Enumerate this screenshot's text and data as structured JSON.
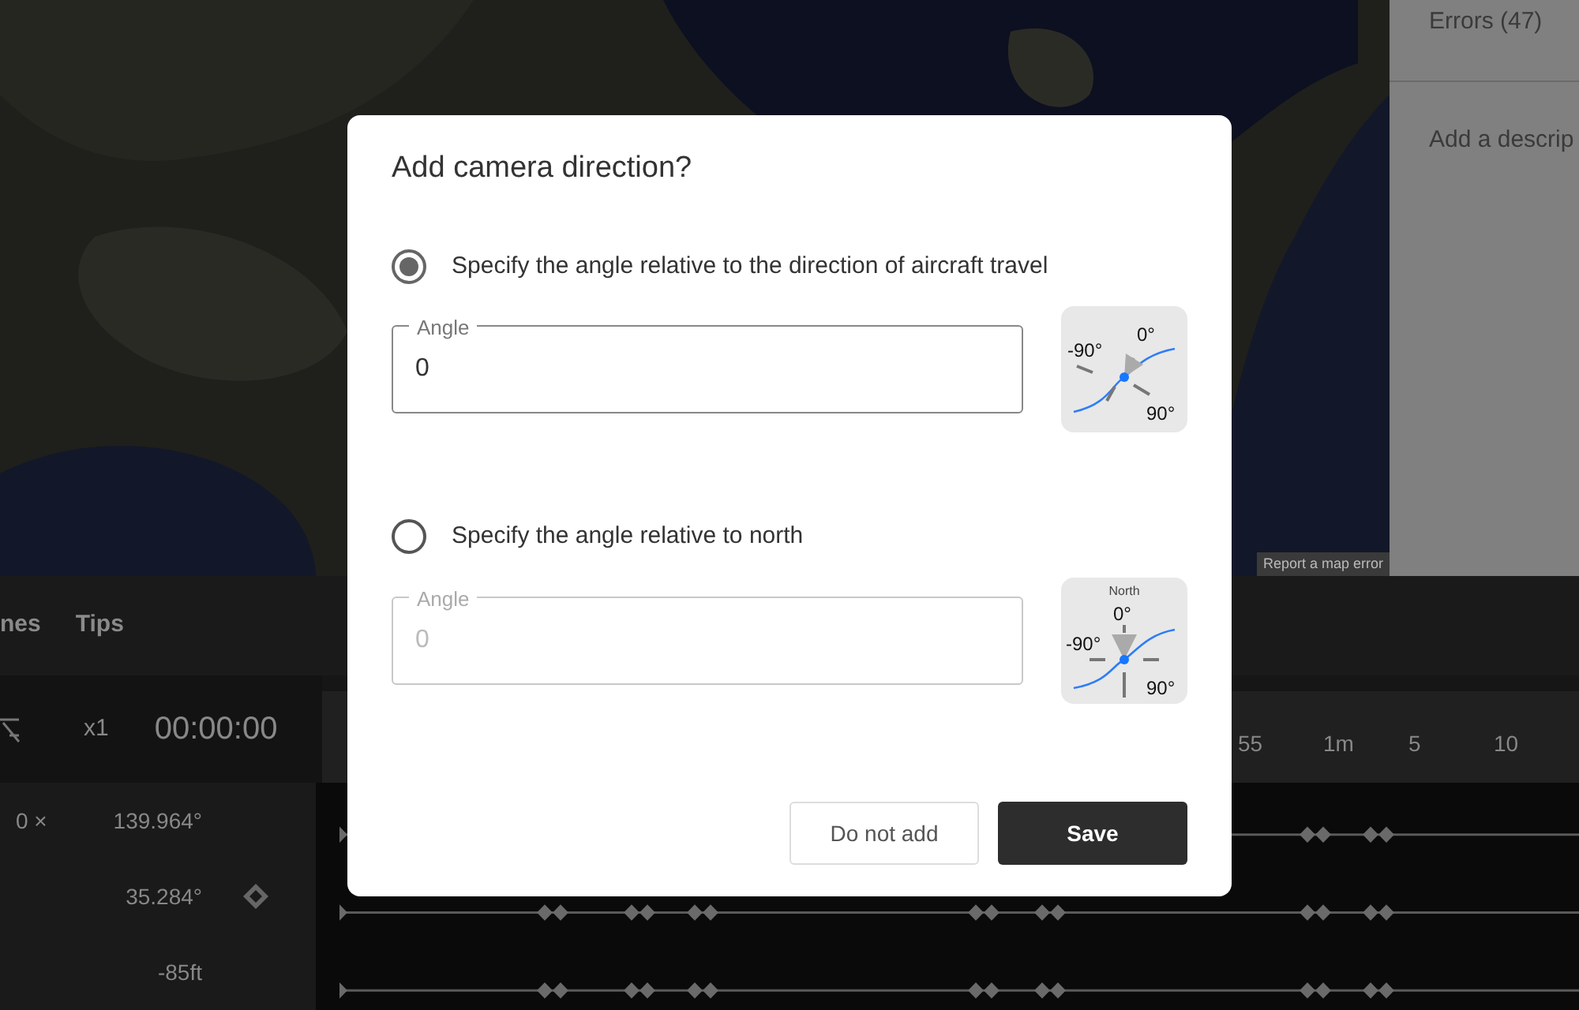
{
  "map": {
    "attribution": "Report a map error"
  },
  "side_panel": {
    "items": [
      "Errors (47)",
      "Add a descrip"
    ]
  },
  "bottom_panel": {
    "tabs": [
      "nes",
      "Tips"
    ],
    "speed": "x1",
    "time": "00:00:00",
    "ruler_labels": [
      "55",
      "1m",
      "5",
      "10"
    ],
    "rows": [
      {
        "count": "0 ×",
        "value": "139.964°",
        "keyframe": false
      },
      {
        "value": "35.284°",
        "keyframe": true
      },
      {
        "value": "-85ft",
        "keyframe": false
      }
    ]
  },
  "dialog": {
    "title": "Add camera direction?",
    "options": [
      {
        "label": "Specify the angle relative to the direction of aircraft travel",
        "selected": true,
        "field": {
          "label": "Angle",
          "value": "0",
          "disabled": false
        },
        "diagram": {
          "kind": "travel",
          "labels": [
            "-90°",
            "0°",
            "90°"
          ]
        }
      },
      {
        "label": "Specify the angle relative to north",
        "selected": false,
        "field": {
          "label": "Angle",
          "value": "0",
          "disabled": true
        },
        "diagram": {
          "kind": "north",
          "title": "North",
          "labels": [
            "-90°",
            "0°",
            "90°"
          ]
        }
      }
    ],
    "buttons": [
      {
        "label": "Do not add",
        "kind": "secondary"
      },
      {
        "label": "Save",
        "kind": "primary"
      }
    ]
  }
}
